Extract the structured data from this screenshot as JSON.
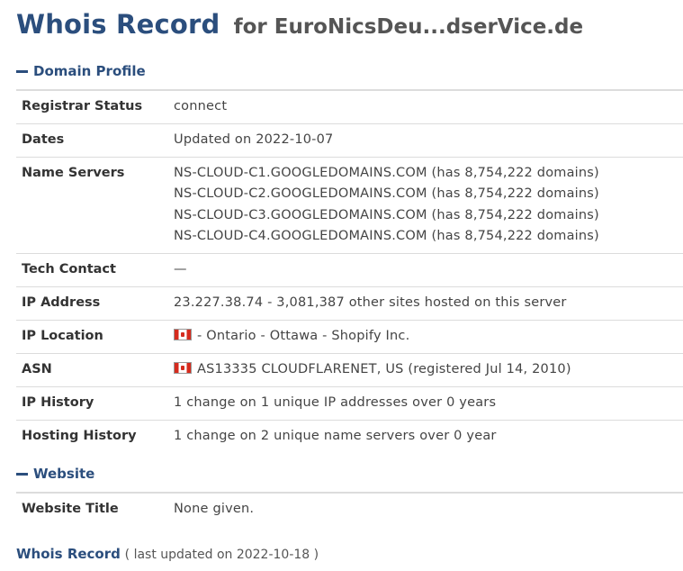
{
  "header": {
    "title": "Whois Record",
    "for_text": "for EuroNicsDeu...dserVice.de"
  },
  "domain_profile": {
    "title": "Domain Profile",
    "rows": [
      {
        "key": "Registrar Status",
        "value": "connect"
      },
      {
        "key": "Dates",
        "value": "Updated on 2022-10-07"
      },
      {
        "key": "Name Servers",
        "values": [
          "NS-CLOUD-C1.GOOGLEDOMAINS.COM (has 8,754,222 domains)",
          "NS-CLOUD-C2.GOOGLEDOMAINS.COM (has 8,754,222 domains)",
          "NS-CLOUD-C3.GOOGLEDOMAINS.COM (has 8,754,222 domains)",
          "NS-CLOUD-C4.GOOGLEDOMAINS.COM (has 8,754,222 domains)"
        ]
      },
      {
        "key": "Tech Contact",
        "value": "—"
      },
      {
        "key": "IP Address",
        "value": "23.227.38.74 - 3,081,387 other sites hosted on this server"
      },
      {
        "key": "IP Location",
        "value": "- Ontario - Ottawa - Shopify Inc.",
        "icon": "canada-flag-icon"
      },
      {
        "key": "ASN",
        "value": "AS13335 CLOUDFLARENET, US (registered Jul 14, 2010)",
        "icon": "canada-flag-icon"
      },
      {
        "key": "IP History",
        "value": "1 change on 1 unique IP addresses over 0 years"
      },
      {
        "key": "Hosting History",
        "value": "1 change on 2 unique name servers over 0 year"
      }
    ]
  },
  "website": {
    "title": "Website",
    "rows": [
      {
        "key": "Website Title",
        "value": "None given."
      }
    ]
  },
  "footer": {
    "link": "Whois Record",
    "meta": "( last updated on 2022-10-18 )"
  },
  "colors": {
    "accent": "#2b4e7d",
    "border": "#dcdcdc"
  }
}
